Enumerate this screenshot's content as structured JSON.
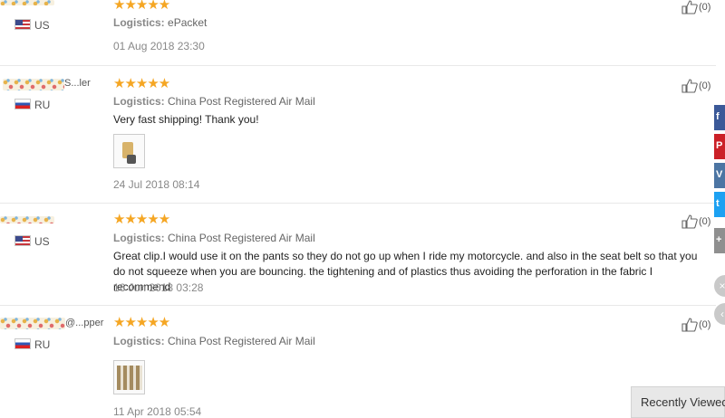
{
  "reviews": [
    {
      "country": "US",
      "flag": "us",
      "stars": "★★★★★",
      "logistics_label": "Logistics:",
      "logistics_value": "ePacket",
      "feedback": "",
      "date": "01 Aug 2018 23:30",
      "likes": "(0)",
      "name_visible": ""
    },
    {
      "country": "RU",
      "flag": "ru",
      "stars": "★★★★★",
      "logistics_label": "Logistics:",
      "logistics_value": "China Post Registered Air Mail",
      "feedback": "Very fast shipping! Thank you!",
      "date": "24 Jul 2018 08:14",
      "likes": "(0)",
      "name_visible": "S...ler"
    },
    {
      "country": "US",
      "flag": "us",
      "stars": "★★★★★",
      "logistics_label": "Logistics:",
      "logistics_value": "China Post Registered Air Mail",
      "feedback": "Great clip.I would use it on the pants so they do not go up when I ride my motorcycle. and also in the seat belt so that you do not squeeze when you are bouncing. the tightening and of plastics thus avoiding the perforation in the fabric I recommend",
      "date": "16 Jun 2018 03:28",
      "likes": "(0)",
      "name_visible": ""
    },
    {
      "country": "RU",
      "flag": "ru",
      "stars": "★★★★★",
      "logistics_label": "Logistics:",
      "logistics_value": "China Post Registered Air Mail",
      "feedback": "",
      "date": "11 Apr 2018 05:54",
      "likes": "(0)",
      "name_visible": "@...pper"
    }
  ],
  "social": [
    "f",
    "P",
    "V",
    "t",
    "+"
  ],
  "recently_viewed": "Recently Viewed",
  "colors": {
    "star": "#f5a623",
    "facebook": "#3b5998",
    "pinterest": "#cb2027",
    "vk": "#4c75a3",
    "twitter": "#1da1f2"
  }
}
